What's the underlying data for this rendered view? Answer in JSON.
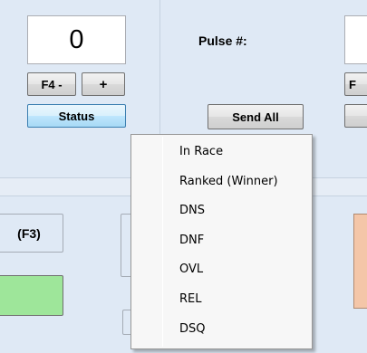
{
  "counter": {
    "value": "0"
  },
  "buttons": {
    "f4_minus": "F4 -",
    "plus": "+",
    "status": "Status",
    "send_all": "Send All",
    "f3": "(F3)",
    "f_partial": "F"
  },
  "pulse": {
    "label": "Pulse #:"
  },
  "status_menu": {
    "items": [
      "In Race",
      "Ranked (Winner)",
      "DNS",
      "DNF",
      "OVL",
      "REL",
      "DSQ"
    ]
  },
  "colors": {
    "panel_bg": "#dfe9f5",
    "status_button": "#bee6fd",
    "green_indicator": "#9ee69a",
    "salmon_indicator": "#f4c6a8"
  }
}
